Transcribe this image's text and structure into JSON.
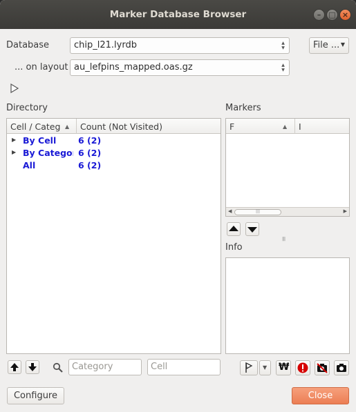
{
  "window": {
    "title": "Marker Database Browser"
  },
  "database": {
    "label": "Database",
    "value": "chip_l21.lyrdb",
    "file_button": "File ...",
    "layout_label": "... on layout",
    "layout_value": "au_lefpins_mapped.oas.gz"
  },
  "directory": {
    "title": "Directory",
    "columns": [
      "Cell / Category",
      "Count (Not Visited)"
    ],
    "rows": [
      {
        "label": "By Cell",
        "count": "6 (2)",
        "expandable": true
      },
      {
        "label": "By Category",
        "count": "6 (2)",
        "expandable": true
      },
      {
        "label": "All",
        "count": "6 (2)",
        "expandable": false
      }
    ],
    "filter_category_placeholder": "Category",
    "filter_cell_placeholder": "Cell"
  },
  "markers": {
    "title": "Markers",
    "columns": [
      "F",
      "I"
    ]
  },
  "info": {
    "title": "Info"
  },
  "footer": {
    "configure": "Configure",
    "close": "Close"
  },
  "colors": {
    "titlebar": "#3c3b37",
    "close_accent": "#f0835a",
    "link_text": "#1a1ad6"
  }
}
